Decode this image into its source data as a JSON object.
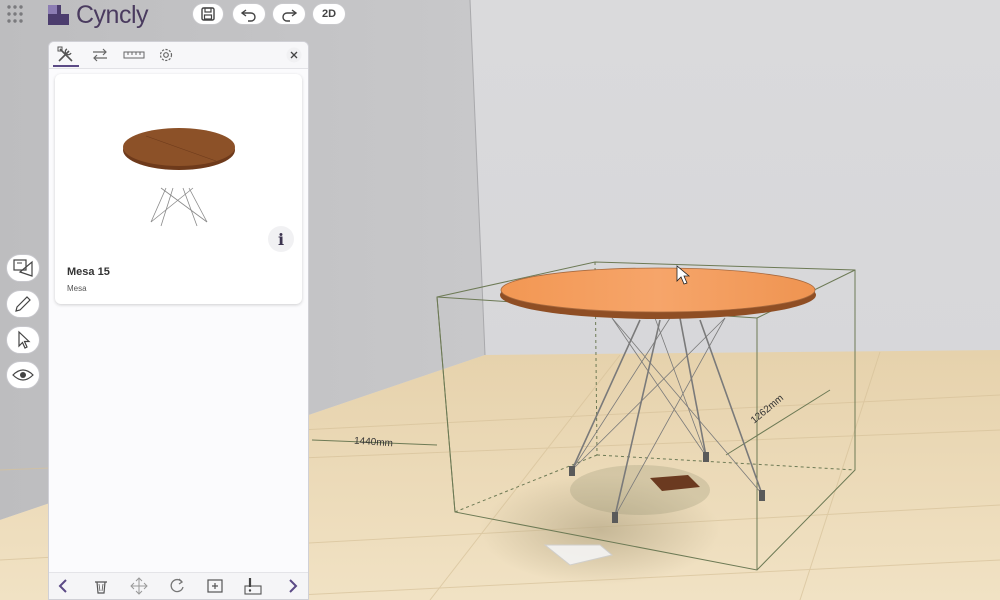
{
  "app": {
    "logo_text": "Cyncly",
    "brand_color": "#5b4a86",
    "view_mode_label": "2D",
    "toolbar_icons": [
      "save-icon",
      "undo-icon",
      "redo-icon"
    ]
  },
  "panel": {
    "tabs": [
      {
        "name": "tools-icon",
        "active": true
      },
      {
        "name": "swap-icon",
        "active": false
      },
      {
        "name": "ruler-icon",
        "active": false
      },
      {
        "name": "gear-icon",
        "active": false
      }
    ],
    "close_icon": "close-icon",
    "product": {
      "title": "Mesa 15",
      "subtitle": "Mesa",
      "info_label": "i"
    },
    "bottom_icons": [
      "chevron-left-icon",
      "delete-icon",
      "move-icon",
      "rotate-icon",
      "add-icon",
      "warning-icon",
      "chevron-right-icon"
    ]
  },
  "side_tools": [
    "area-measure-icon",
    "pencil-icon",
    "cursor-icon",
    "eye-icon"
  ],
  "scene": {
    "width_label": "1440mm",
    "depth_label": "1262mm",
    "tabletop_color": "#f39a58",
    "floor_color": "#ecd9b6"
  }
}
